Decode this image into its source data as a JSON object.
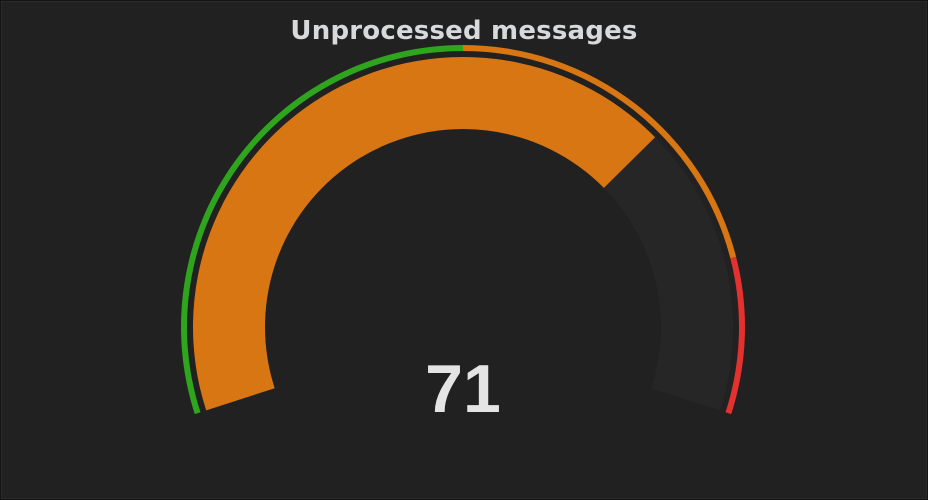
{
  "panel": {
    "title": "Unprocessed messages"
  },
  "chart_data": {
    "type": "gauge",
    "value": 71,
    "value_label": "71",
    "min": 0,
    "max": 100,
    "value_color": "#d97614",
    "track_color": "#262626",
    "thresholds": [
      {
        "from": 0,
        "to": 50,
        "color": "#2ea51d"
      },
      {
        "from": 50,
        "to": 85,
        "color": "#d97614"
      },
      {
        "from": 85,
        "to": 100,
        "color": "#e2312e"
      }
    ]
  }
}
